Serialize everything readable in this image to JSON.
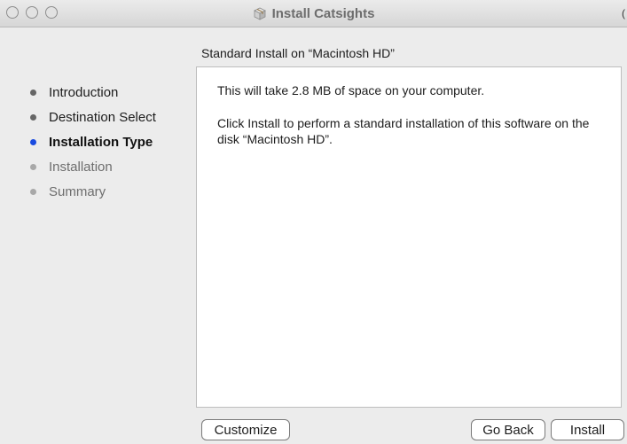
{
  "window": {
    "title": "Install Catsights",
    "title_icon": "package-icon",
    "edge_glyph": "("
  },
  "sidebar": {
    "steps": [
      {
        "label": "Introduction",
        "state": "done"
      },
      {
        "label": "Destination Select",
        "state": "done"
      },
      {
        "label": "Installation Type",
        "state": "current"
      },
      {
        "label": "Installation",
        "state": "future"
      },
      {
        "label": "Summary",
        "state": "future"
      }
    ]
  },
  "main": {
    "heading": "Standard Install on “Macintosh HD”",
    "paragraph1": "This will take 2.8 MB of space on your computer.",
    "paragraph2": "Click Install to perform a standard installation of this software on the disk “Macintosh HD”."
  },
  "buttons": {
    "customize": "Customize",
    "go_back": "Go Back",
    "install": "Install"
  },
  "colors": {
    "current_step_dot": "#1a4be0",
    "done_step_dot": "#666666",
    "future_step_dot": "#a8a8a8",
    "window_background": "#ececec"
  }
}
